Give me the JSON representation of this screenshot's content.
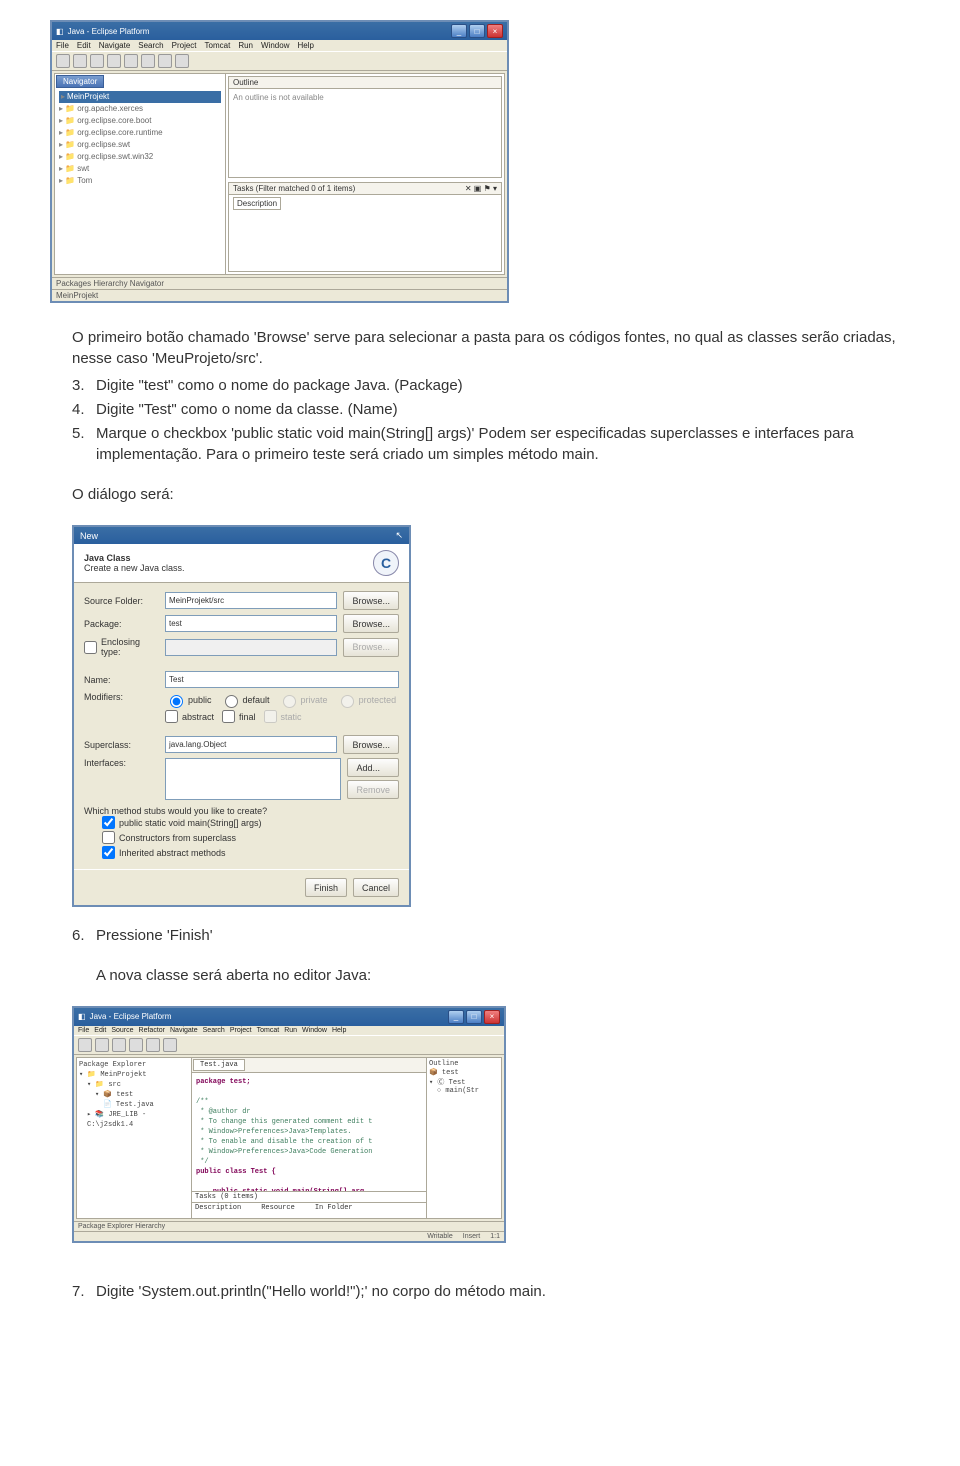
{
  "eclipse1": {
    "window_title": "Java - Eclipse Platform",
    "menubar": [
      "File",
      "Edit",
      "Navigate",
      "Search",
      "Project",
      "Tomcat",
      "Run",
      "Window",
      "Help"
    ],
    "navigator_tab": "Navigator",
    "nav_items": [
      "MeinProjekt",
      "org.apache.xerces",
      "org.eclipse.core.boot",
      "org.eclipse.core.runtime",
      "org.eclipse.swt",
      "org.eclipse.swt.win32",
      "swt",
      "Tom"
    ],
    "outline_title": "Outline",
    "outline_body": "An outline is not available",
    "tasks_title": "Tasks (Filter matched 0 of 1 items)",
    "desc_tab": "Description",
    "status_left": "Packages  Hierarchy  Navigator",
    "status_right": "MeinProjekt"
  },
  "text": {
    "intro": "O primeiro botão chamado 'Browse' serve para selecionar a pasta para os códigos fontes, no qual as classes serão criadas, nesse caso 'MeuProjeto/src'.",
    "step3_n": "3.",
    "step3": "Digite \"test\" como o nome do package Java. (Package)",
    "step4_n": "4.",
    "step4": "Digite \"Test\" como o nome da classe. (Name)",
    "step5_n": "5.",
    "step5": "Marque o checkbox 'public static void main(String[] args)' Podem ser especificadas superclasses e interfaces para implementação. Para o primeiro teste será criado um simples método main.",
    "dialog_intro": "O diálogo será:",
    "step6_n": "6.",
    "step6": "Pressione 'Finish'",
    "after6": "A nova classe será aberta no editor Java:",
    "step7_n": "7.",
    "step7": "Digite 'System.out.println(\"Hello world!\");' no corpo do método main."
  },
  "dialog": {
    "title": "New",
    "banner_title": "Java Class",
    "banner_desc": "Create a new Java class.",
    "icon_letter": "C",
    "lbl_source": "Source Folder:",
    "val_source": "MeinProjekt/src",
    "lbl_package": "Package:",
    "val_package": "test",
    "chk_enclosing": "Enclosing type:",
    "lbl_name": "Name:",
    "val_name": "Test",
    "lbl_mod": "Modifiers:",
    "r_public": "public",
    "r_default": "default",
    "r_private": "private",
    "r_protected": "protected",
    "c_abstract": "abstract",
    "c_final": "final",
    "c_static": "static",
    "lbl_super": "Superclass:",
    "val_super": "java.lang.Object",
    "lbl_if": "Interfaces:",
    "btn_browse": "Browse...",
    "btn_add": "Add...",
    "btn_remove": "Remove",
    "stub_q": "Which method stubs would you like to create?",
    "stub_main": "public static void main(String[] args)",
    "stub_ctor": "Constructors from superclass",
    "stub_inh": "Inherited abstract methods",
    "btn_finish": "Finish",
    "btn_cancel": "Cancel"
  },
  "eclipse2": {
    "window_title": "Java - Eclipse Platform",
    "menubar": [
      "File",
      "Edit",
      "Source",
      "Refactor",
      "Navigate",
      "Search",
      "Project",
      "Tomcat",
      "Run",
      "Window",
      "Help"
    ],
    "pkg_title": "Package Explorer",
    "pkg_root": "MeinProjekt",
    "pkg_src": "src",
    "pkg_pkg": "test",
    "pkg_file": "Test.java",
    "pkg_jre": "JRE_LIB - C:\\j2sdk1.4",
    "editor_tab": "Test.java",
    "code_pkg": "package test;",
    "code_cmt1": "/**",
    "code_cmt2": " * @author dr",
    "code_cmt3": " * To change this generated comment edit t",
    "code_cmt4": " * Window>Preferences>Java>Templates.",
    "code_cmt5": " * To enable and disable the creation of t",
    "code_cmt6": " * Window>Preferences>Java>Code Generation",
    "code_cmt7": " */",
    "code_cls": "public class Test {",
    "code_main": "    public static void main(String[] arg",
    "code_body": "    }",
    "code_end": "}",
    "outline_title": "Outline",
    "outline_i1": "test",
    "outline_i2": "Test",
    "outline_i3": "main(Str",
    "tasks_title": "Tasks (0 items)",
    "tasks_cols": [
      "Description",
      "Resource",
      "In Folder"
    ],
    "bottom_tabs": "Package Explorer  Hierarchy",
    "status": [
      "Writable",
      "Insert",
      "1:1"
    ]
  }
}
